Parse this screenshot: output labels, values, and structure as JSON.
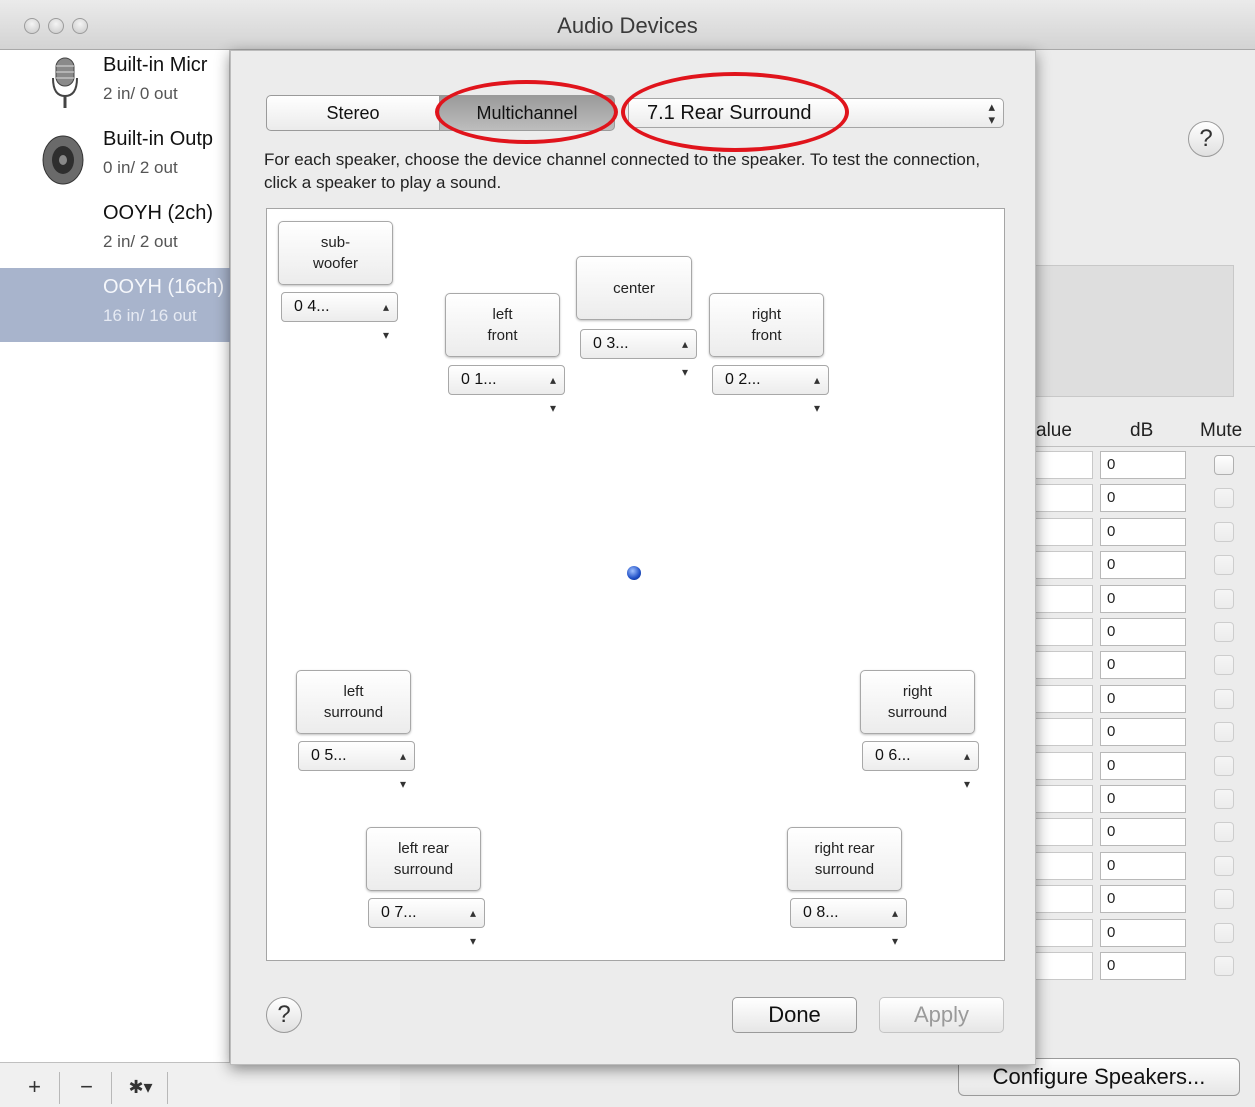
{
  "window": {
    "title": "Audio Devices"
  },
  "sidebar": {
    "devices": [
      {
        "name": "Built-in Micr",
        "io": "2 in/ 0 out",
        "icon": "microphone-icon"
      },
      {
        "name": "Built-in Outp",
        "io": "0 in/ 2 out",
        "icon": "speaker-icon"
      },
      {
        "name": "OOYH (2ch)",
        "io": "2 in/ 2 out"
      },
      {
        "name": "OOYH (16ch)",
        "io": "16 in/ 16 out",
        "selected": true
      }
    ],
    "add_label": "+",
    "remove_label": "−",
    "gear_label": "✱▾"
  },
  "right_panel": {
    "help": "?",
    "columns": {
      "value": "alue",
      "db": "dB",
      "mute": "Mute"
    },
    "db_values": [
      "0",
      "0",
      "0",
      "0",
      "0",
      "0",
      "0",
      "0",
      "0",
      "0",
      "0",
      "0",
      "0",
      "0",
      "0",
      "0"
    ],
    "configure_label": "Configure Speakers..."
  },
  "sheet": {
    "tabs": {
      "stereo": "Stereo",
      "multichannel": "Multichannel"
    },
    "layout_popup": "7.1 Rear Surround",
    "instructions": "For each speaker, choose the device channel connected to the speaker. To test the connection, click a speaker to play a sound.",
    "speakers": {
      "subwoofer": {
        "label": "sub-\nwoofer",
        "channel": "0   4..."
      },
      "left_front": {
        "label": "left\nfront",
        "channel": "0   1..."
      },
      "center": {
        "label": "center",
        "channel": "0   3..."
      },
      "right_front": {
        "label": "right\nfront",
        "channel": "0   2..."
      },
      "left_surround": {
        "label": "left\nsurround",
        "channel": "0   5..."
      },
      "right_surround": {
        "label": "right\nsurround",
        "channel": "0   6..."
      },
      "left_rear_surround": {
        "label": "left rear\nsurround",
        "channel": "0   7..."
      },
      "right_rear_surround": {
        "label": "right rear\nsurround",
        "channel": "0   8..."
      }
    },
    "help": "?",
    "done_label": "Done",
    "apply_label": "Apply"
  },
  "colors": {
    "highlight_ring": "#e0141c",
    "selection": "#a8b4cc"
  }
}
